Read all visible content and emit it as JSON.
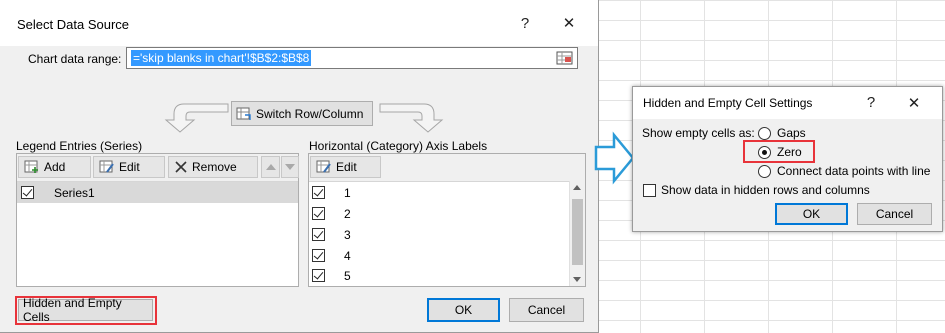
{
  "select_dialog": {
    "title": "Select Data Source",
    "help_glyph": "?",
    "close_glyph": "✕",
    "range_label": "Chart data range:",
    "range_value": "='skip blanks in chart'!$B$2:$B$8",
    "switch_button": "Switch Row/Column",
    "legend_header": "Legend Entries (Series)",
    "axis_header": "Horizontal (Category) Axis Labels",
    "add_button": "Add",
    "edit_button": "Edit",
    "remove_button": "Remove",
    "axis_edit_button": "Edit",
    "series": [
      {
        "name": "Series1",
        "checked": true
      }
    ],
    "axis_labels": [
      {
        "label": "1",
        "checked": true
      },
      {
        "label": "2",
        "checked": true
      },
      {
        "label": "3",
        "checked": true
      },
      {
        "label": "4",
        "checked": true
      },
      {
        "label": "5",
        "checked": true
      }
    ],
    "hidden_cells_button": "Hidden and Empty Cells",
    "ok_button": "OK",
    "cancel_button": "Cancel"
  },
  "hidden_dialog": {
    "title": "Hidden and Empty Cell Settings",
    "help_glyph": "?",
    "close_glyph": "✕",
    "show_empty_label": "Show empty cells as:",
    "options": [
      {
        "label": "Gaps",
        "selected": false
      },
      {
        "label": "Zero",
        "selected": true
      },
      {
        "label": "Connect data points with line",
        "selected": false
      }
    ],
    "show_hidden_label": "Show data in hidden rows and columns",
    "show_hidden_checked": false,
    "ok_button": "OK",
    "cancel_button": "Cancel"
  },
  "colors": {
    "highlight": "#e8333a",
    "arrow_outline": "#2b9bd8",
    "selection": "#3399ff",
    "default_button_border": "#0078d7"
  }
}
